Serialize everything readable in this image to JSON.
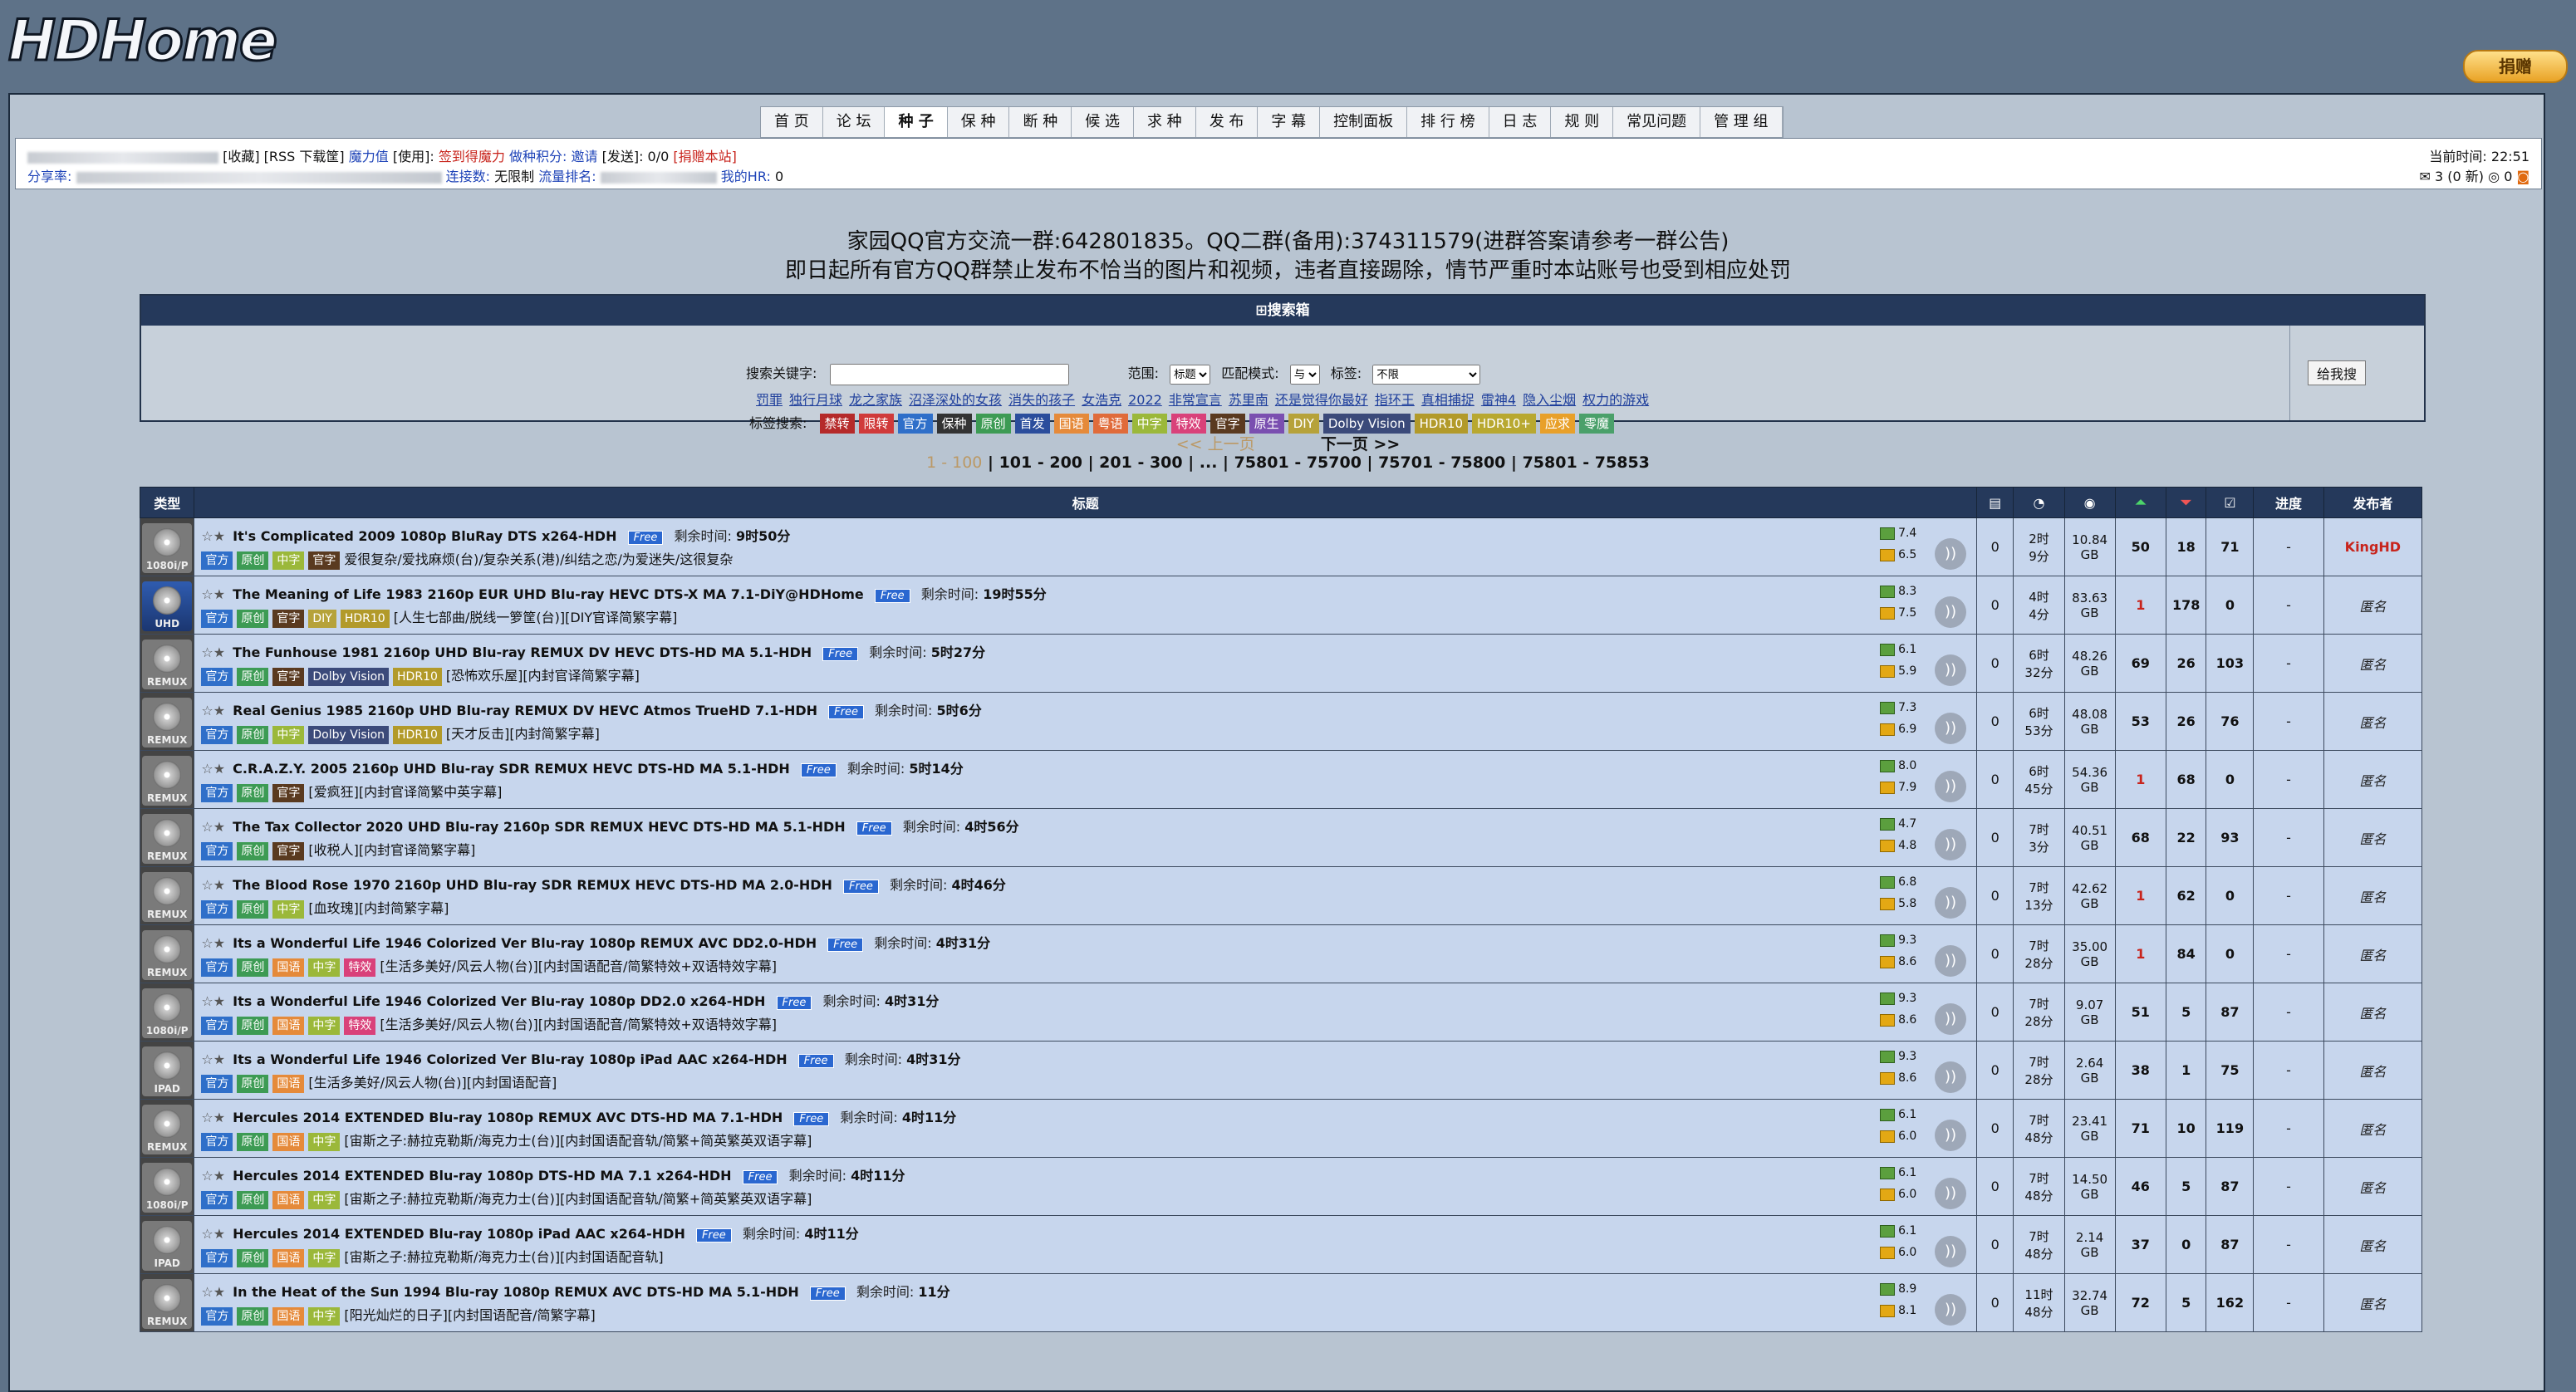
{
  "logo": "HDHome",
  "donate_label": "捐赠",
  "nav": [
    "首 页",
    "论 坛",
    "种 子",
    "保 种",
    "断 种",
    "候 选",
    "求 种",
    "发 布",
    "字 幕",
    "控制面板",
    "排 行 榜",
    "日 志",
    "规 则",
    "常见问题",
    "管 理 组"
  ],
  "nav_active": 2,
  "userinfo": {
    "line1": "[收藏] [RSS 下载筐]",
    "magic": "魔力值",
    "use": "[使用]:",
    "sign": "签到得魔力",
    "seed_points": "做种积分:",
    "invite": "邀请",
    "invite_sent": "[发送]: 0/0",
    "donate_site": "[捐赠本站]",
    "share_ratio_label": "分享率:",
    "connections_label": "连接数:",
    "connections": "无限制",
    "traffic_rank": "流量排名:",
    "my_hr": "我的HR:",
    "my_hr_val": "0",
    "current_time_label": "当前时间:",
    "current_time": "22:51",
    "messages": "3 (0 新)",
    "msg2": "0"
  },
  "announce": {
    "line1": "家园QQ官方交流一群:642801835。QQ二群(备用):374311579(进群答案请参考一群公告)",
    "line2": "即日起所有官方QQ群禁止发布不恰当的图片和视频，违者直接踢除，情节严重时本站账号也受到相应处罚"
  },
  "search": {
    "header": "搜索箱",
    "keyword_label": "搜索关键字:",
    "scope_label": "范围:",
    "scope_value": "标题",
    "match_label": "匹配模式:",
    "match_value": "与",
    "tag_label": "标签:",
    "tag_value": "不限",
    "quick_links": [
      "罚罪",
      "独行月球",
      "龙之家族",
      "沼泽深处的女孩",
      "消失的孩子",
      "女浩克",
      "2022",
      "非常宣言",
      "苏里南",
      "还是觉得你最好",
      "指环王",
      "真相捕捉",
      "雷神4",
      "隐入尘烟",
      "权力的游戏"
    ],
    "tagsearch_label": "标签搜索:",
    "tags": [
      {
        "label": "禁转",
        "color": "#b52a2a"
      },
      {
        "label": "限转",
        "color": "#d03a3a"
      },
      {
        "label": "官方",
        "color": "#2f6fc9"
      },
      {
        "label": "保种",
        "color": "#333333"
      },
      {
        "label": "原创",
        "color": "#3d9b54"
      },
      {
        "label": "首发",
        "color": "#2b4d9c"
      },
      {
        "label": "国语",
        "color": "#e58a3a"
      },
      {
        "label": "粤语",
        "color": "#e06b3a"
      },
      {
        "label": "中字",
        "color": "#9bb83a"
      },
      {
        "label": "特效",
        "color": "#d9417a"
      },
      {
        "label": "官字",
        "color": "#5a3a20"
      },
      {
        "label": "原生",
        "color": "#7a4fb0"
      },
      {
        "label": "DIY",
        "color": "#b6a23a"
      },
      {
        "label": "Dolby Vision",
        "color": "#3b4a7a"
      },
      {
        "label": "HDR10",
        "color": "#b29a2a"
      },
      {
        "label": "HDR10+",
        "color": "#b8a830"
      },
      {
        "label": "应求",
        "color": "#e8a02a"
      },
      {
        "label": "零魔",
        "color": "#4aa06a"
      }
    ],
    "button": "给我搜"
  },
  "pager": {
    "prev": "<< 上一页",
    "next": "下一页 >>",
    "pages": "1 - 100 | 101 - 200 | 201 - 300 | ... | 75801 - 75700 | 75701 - 75800 | 75801 - 75853",
    "current": "1 - 100"
  },
  "table": {
    "headers": {
      "type": "类型",
      "title": "标题",
      "progress": "进度",
      "uploader": "发布者"
    },
    "rows": [
      {
        "cat": "1080i/P",
        "name": "It's Complicated 2009 1080p BluRay DTS x264-HDH",
        "remain": "9时50分",
        "tags": [
          "官方",
          "原创",
          "中字",
          "官字"
        ],
        "sub": "爱很复杂/爱找麻烦(台)/复杂关系(港)/纠结之恋/为爱迷失/这很复杂",
        "imdb": "7.4",
        "douban": "6.5",
        "comments": "0",
        "age": "2时\n9分",
        "size": "10.84\nGB",
        "seeders": "50",
        "leechers": "18",
        "done": "71",
        "progress": "-",
        "uploader": "KingHD",
        "seed_red": false
      },
      {
        "cat": "UHD",
        "name": "The Meaning of Life 1983 2160p EUR UHD Blu-ray HEVC DTS-X MA 7.1-DiY@HDHome",
        "remain": "19时55分",
        "tags": [
          "官方",
          "原创",
          "官字",
          "DIY",
          "HDR10"
        ],
        "sub": "[人生七部曲/脱线一箩筐(台)][DIY官译简繁字幕]",
        "imdb": "8.3",
        "douban": "7.5",
        "comments": "0",
        "age": "4时\n4分",
        "size": "83.63\nGB",
        "seeders": "1",
        "leechers": "178",
        "done": "0",
        "progress": "-",
        "uploader": "匿名",
        "seed_red": true
      },
      {
        "cat": "REMUX",
        "name": "The Funhouse 1981 2160p UHD Blu-ray REMUX DV HEVC DTS-HD MA 5.1-HDH",
        "remain": "5时27分",
        "tags": [
          "官方",
          "原创",
          "官字",
          "Dolby Vision",
          "HDR10"
        ],
        "sub": "[恐怖欢乐屋][内封官译简繁字幕]",
        "imdb": "6.1",
        "douban": "5.9",
        "comments": "0",
        "age": "6时\n32分",
        "size": "48.26\nGB",
        "seeders": "69",
        "leechers": "26",
        "done": "103",
        "progress": "-",
        "uploader": "匿名",
        "seed_red": false
      },
      {
        "cat": "REMUX",
        "name": "Real Genius 1985 2160p UHD Blu-ray REMUX DV HEVC Atmos TrueHD 7.1-HDH",
        "remain": "5时6分",
        "tags": [
          "官方",
          "原创",
          "中字",
          "Dolby Vision",
          "HDR10"
        ],
        "sub": "[天才反击][内封简繁字幕]",
        "imdb": "7.3",
        "douban": "6.9",
        "comments": "0",
        "age": "6时\n53分",
        "size": "48.08\nGB",
        "seeders": "53",
        "leechers": "26",
        "done": "76",
        "progress": "-",
        "uploader": "匿名",
        "seed_red": false
      },
      {
        "cat": "REMUX",
        "name": "C.R.A.Z.Y. 2005 2160p UHD Blu-ray SDR REMUX HEVC DTS-HD MA 5.1-HDH",
        "remain": "5时14分",
        "tags": [
          "官方",
          "原创",
          "官字"
        ],
        "sub": "[爱疯狂][内封官译简繁中英字幕]",
        "imdb": "8.0",
        "douban": "7.9",
        "comments": "0",
        "age": "6时\n45分",
        "size": "54.36\nGB",
        "seeders": "1",
        "leechers": "68",
        "done": "0",
        "progress": "-",
        "uploader": "匿名",
        "seed_red": true
      },
      {
        "cat": "REMUX",
        "name": "The Tax Collector 2020 UHD Blu-ray 2160p SDR REMUX HEVC DTS-HD MA 5.1-HDH",
        "remain": "4时56分",
        "tags": [
          "官方",
          "原创",
          "官字"
        ],
        "sub": "[收税人][内封官译简繁字幕]",
        "imdb": "4.7",
        "douban": "4.8",
        "comments": "0",
        "age": "7时\n3分",
        "size": "40.51\nGB",
        "seeders": "68",
        "leechers": "22",
        "done": "93",
        "progress": "-",
        "uploader": "匿名",
        "seed_red": false
      },
      {
        "cat": "REMUX",
        "name": "The Blood Rose 1970 2160p UHD Blu-ray SDR REMUX HEVC DTS-HD MA 2.0-HDH",
        "remain": "4时46分",
        "tags": [
          "官方",
          "原创",
          "中字"
        ],
        "sub": "[血玫瑰][内封简繁字幕]",
        "imdb": "6.8",
        "douban": "5.8",
        "comments": "0",
        "age": "7时\n13分",
        "size": "42.62\nGB",
        "seeders": "1",
        "leechers": "62",
        "done": "0",
        "progress": "-",
        "uploader": "匿名",
        "seed_red": true
      },
      {
        "cat": "REMUX",
        "name": "Its a Wonderful Life 1946 Colorized Ver Blu-ray 1080p REMUX AVC DD2.0-HDH",
        "remain": "4时31分",
        "tags": [
          "官方",
          "原创",
          "国语",
          "中字",
          "特效"
        ],
        "sub": "[生活多美好/风云人物(台)][内封国语配音/简繁特效+双语特效字幕]",
        "imdb": "9.3",
        "douban": "8.6",
        "comments": "0",
        "age": "7时\n28分",
        "size": "35.00\nGB",
        "seeders": "1",
        "leechers": "84",
        "done": "0",
        "progress": "-",
        "uploader": "匿名",
        "seed_red": true
      },
      {
        "cat": "1080i/P",
        "name": "Its a Wonderful Life 1946 Colorized Ver Blu-ray 1080p DD2.0 x264-HDH",
        "remain": "4时31分",
        "tags": [
          "官方",
          "原创",
          "国语",
          "中字",
          "特效"
        ],
        "sub": "[生活多美好/风云人物(台)][内封国语配音/简繁特效+双语特效字幕]",
        "imdb": "9.3",
        "douban": "8.6",
        "comments": "0",
        "age": "7时\n28分",
        "size": "9.07\nGB",
        "seeders": "51",
        "leechers": "5",
        "done": "87",
        "progress": "-",
        "uploader": "匿名",
        "seed_red": false
      },
      {
        "cat": "IPAD",
        "name": "Its a Wonderful Life 1946 Colorized Ver Blu-ray 1080p iPad AAC x264-HDH",
        "remain": "4时31分",
        "tags": [
          "官方",
          "原创",
          "国语"
        ],
        "sub": "[生活多美好/风云人物(台)][内封国语配音]",
        "imdb": "9.3",
        "douban": "8.6",
        "comments": "0",
        "age": "7时\n28分",
        "size": "2.64\nGB",
        "seeders": "38",
        "leechers": "1",
        "done": "75",
        "progress": "-",
        "uploader": "匿名",
        "seed_red": false
      },
      {
        "cat": "REMUX",
        "name": "Hercules 2014 EXTENDED Blu-ray 1080p REMUX AVC DTS-HD MA 7.1-HDH",
        "remain": "4时11分",
        "tags": [
          "官方",
          "原创",
          "国语",
          "中字"
        ],
        "sub": "[宙斯之子:赫拉克勒斯/海克力士(台)][内封国语配音轨/简繁+简英繁英双语字幕]",
        "imdb": "6.1",
        "douban": "6.0",
        "comments": "0",
        "age": "7时\n48分",
        "size": "23.41\nGB",
        "seeders": "71",
        "leechers": "10",
        "done": "119",
        "progress": "-",
        "uploader": "匿名",
        "seed_red": false
      },
      {
        "cat": "1080i/P",
        "name": "Hercules 2014 EXTENDED Blu-ray 1080p DTS-HD MA 7.1 x264-HDH",
        "remain": "4时11分",
        "tags": [
          "官方",
          "原创",
          "国语",
          "中字"
        ],
        "sub": "[宙斯之子:赫拉克勒斯/海克力士(台)][内封国语配音轨/简繁+简英繁英双语字幕]",
        "imdb": "6.1",
        "douban": "6.0",
        "comments": "0",
        "age": "7时\n48分",
        "size": "14.50\nGB",
        "seeders": "46",
        "leechers": "5",
        "done": "87",
        "progress": "-",
        "uploader": "匿名",
        "seed_red": false
      },
      {
        "cat": "IPAD",
        "name": "Hercules 2014 EXTENDED Blu-ray 1080p iPad AAC x264-HDH",
        "remain": "4时11分",
        "tags": [
          "官方",
          "原创",
          "国语",
          "中字"
        ],
        "sub": "[宙斯之子:赫拉克勒斯/海克力士(台)][内封国语配音轨]",
        "imdb": "6.1",
        "douban": "6.0",
        "comments": "0",
        "age": "7时\n48分",
        "size": "2.14\nGB",
        "seeders": "37",
        "leechers": "0",
        "done": "87",
        "progress": "-",
        "uploader": "匿名",
        "seed_red": false
      },
      {
        "cat": "REMUX",
        "name": "In the Heat of the Sun 1994 Blu-ray 1080p REMUX AVC DTS-HD MA 5.1-HDH",
        "remain": "11分",
        "tags": [
          "官方",
          "原创",
          "国语",
          "中字"
        ],
        "sub": "[阳光灿烂的日子][内封国语配音/简繁字幕]",
        "imdb": "8.9",
        "douban": "8.1",
        "comments": "0",
        "age": "11时\n48分",
        "size": "32.74\nGB",
        "seeders": "72",
        "leechers": "5",
        "done": "162",
        "progress": "-",
        "uploader": "匿名",
        "seed_red": false
      }
    ],
    "free_label": "Free",
    "remain_label": "剩余时间:"
  }
}
